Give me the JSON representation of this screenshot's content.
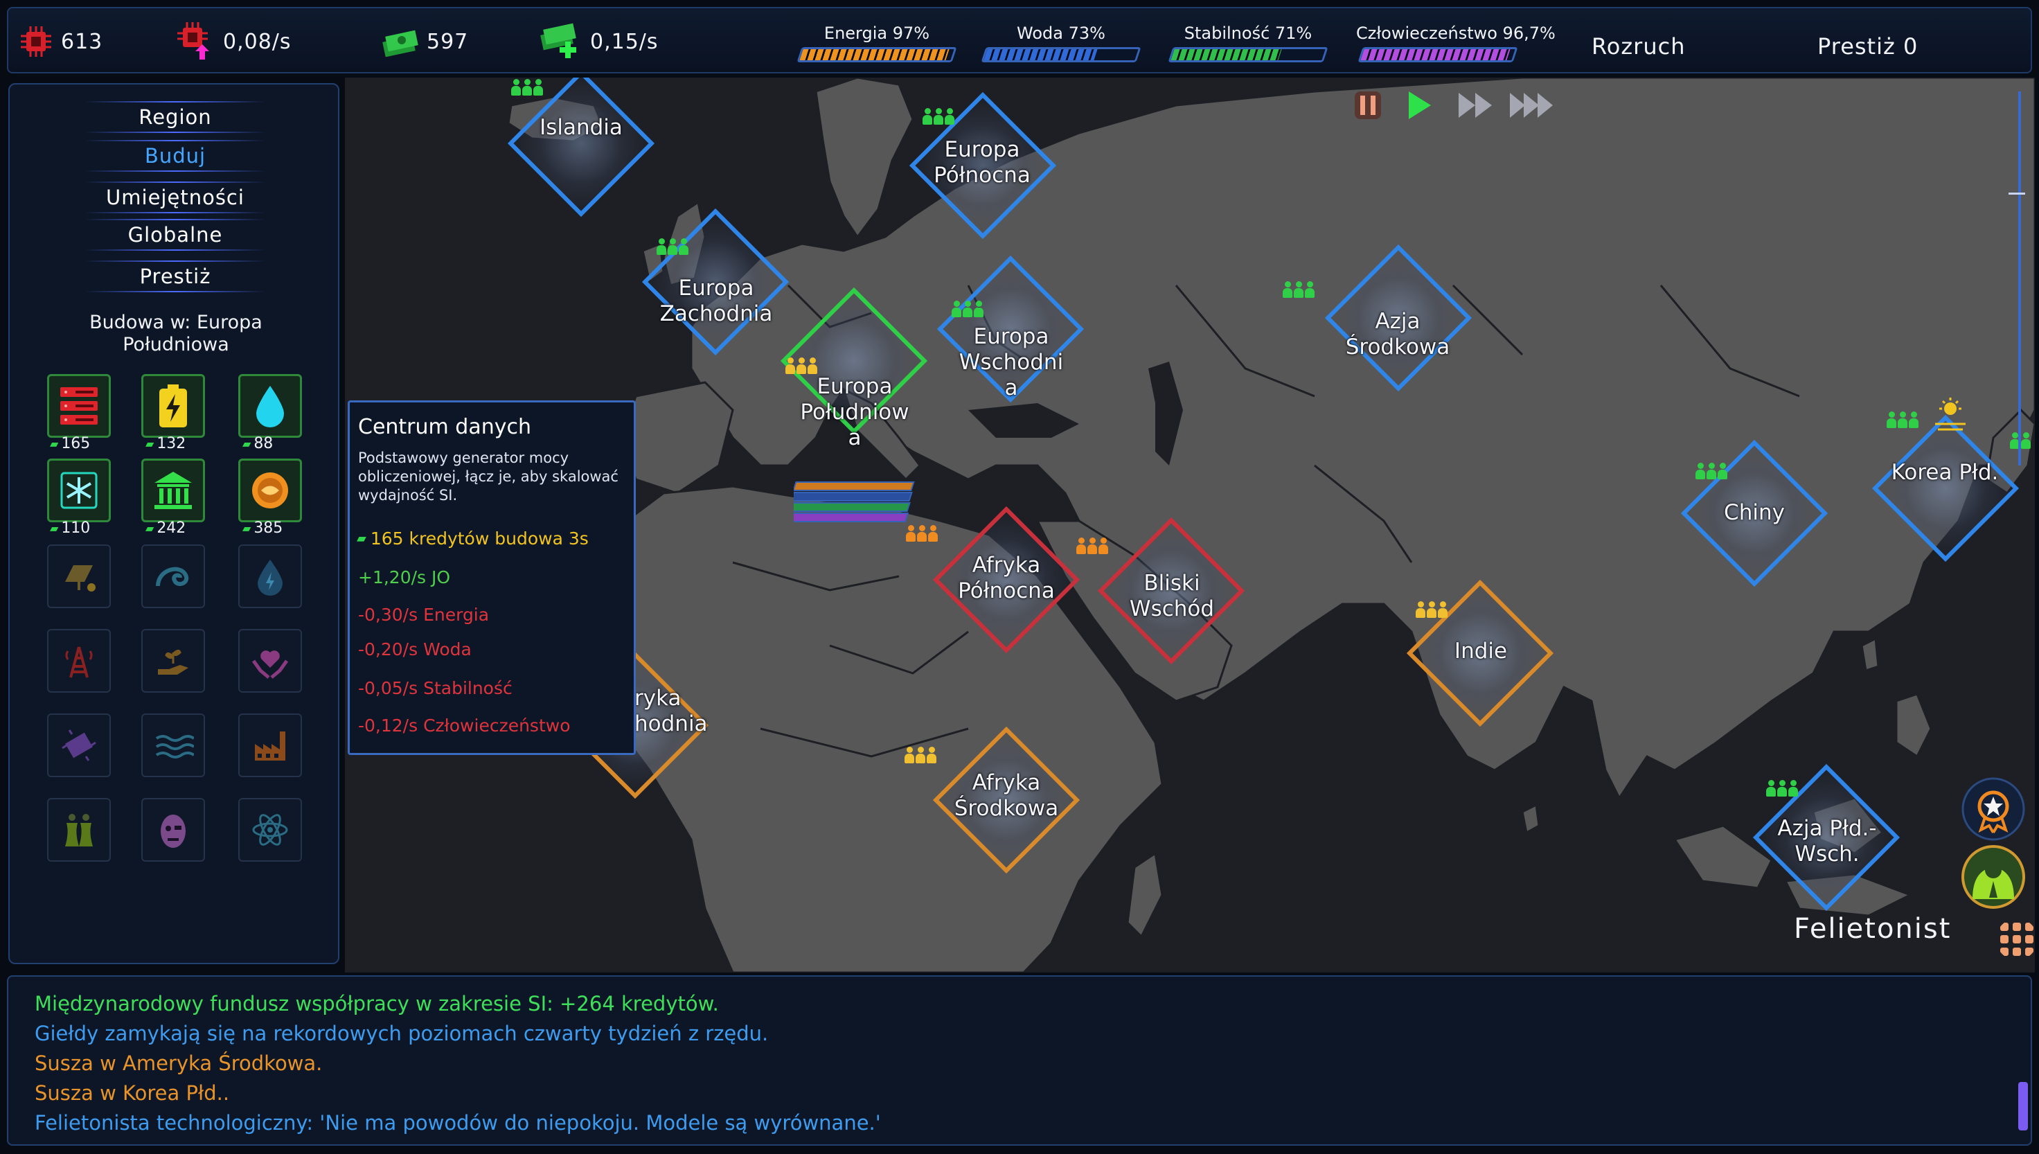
{
  "topbar": {
    "compute": {
      "value": "613",
      "icon": "cpu-icon"
    },
    "compute_rate": {
      "value": "0,08/s",
      "icon": "cpu-rate-icon"
    },
    "credits": {
      "value": "597",
      "icon": "cash-icon"
    },
    "credits_rate": {
      "value": "0,15/s",
      "icon": "cash-rate-icon"
    },
    "meters": [
      {
        "label": "Energia 97%",
        "level": 0.97,
        "color": "#f0921e"
      },
      {
        "label": "Woda 73%",
        "level": 0.73,
        "color": "#2f6ad8"
      },
      {
        "label": "Stabilność 71%",
        "level": 0.71,
        "color": "#2fbf4a"
      },
      {
        "label": "Człowieczeństwo 96,7%",
        "level": 0.967,
        "color": "#b44ee0"
      }
    ],
    "phase": "Rozruch",
    "prestige": "Prestiż 0"
  },
  "nav": {
    "items": [
      {
        "label": "Region",
        "active": false
      },
      {
        "label": "Buduj",
        "active": true
      },
      {
        "label": "Umiejętności",
        "active": false
      },
      {
        "label": "Globalne",
        "active": false
      },
      {
        "label": "Prestiż",
        "active": false
      }
    ]
  },
  "build": {
    "location_label": "Budowa w: Europa Południowa",
    "items": [
      {
        "icon": "server-rack-icon",
        "cost": "165",
        "available": true
      },
      {
        "icon": "battery-icon",
        "cost": "132",
        "available": true
      },
      {
        "icon": "water-drop-icon",
        "cost": "88",
        "available": true
      },
      {
        "icon": "snowflake-cooling-icon",
        "cost": "110",
        "available": true
      },
      {
        "icon": "government-building-icon",
        "cost": "242",
        "available": true
      },
      {
        "icon": "coin-icon",
        "cost": "385",
        "available": true
      },
      {
        "icon": "solar-panel-icon",
        "available": false
      },
      {
        "icon": "wave-icon",
        "available": false
      },
      {
        "icon": "drop-energy-icon",
        "available": false
      },
      {
        "icon": "radio-tower-icon",
        "available": false
      },
      {
        "icon": "hand-plant-icon",
        "available": false
      },
      {
        "icon": "heart-hands-icon",
        "available": false
      },
      {
        "icon": "chip-icon",
        "available": false
      },
      {
        "icon": "water-waves-icon",
        "available": false
      },
      {
        "icon": "factory-icon",
        "available": false
      },
      {
        "icon": "nuclear-plant-icon",
        "available": false
      },
      {
        "icon": "robot-face-icon",
        "available": false
      },
      {
        "icon": "atom-icon",
        "available": false
      }
    ]
  },
  "tooltip": {
    "title": "Centrum danych",
    "description": "Podstawowy generator mocy obliczeniowej, łącz je, aby skalować wydajność SI.",
    "cost_line": "165 kredytów  budowa 3s",
    "gain_line": "+1,20/s JO",
    "energy_line": "-0,30/s Energia",
    "water_line": "-0,20/s Woda",
    "stability_line": "-0,05/s Stabilność",
    "humanity_line": "-0,12/s Człowieczeństwo"
  },
  "regions": [
    {
      "name": "Islandia",
      "state": "blue",
      "people": "green"
    },
    {
      "name": "Europa Północna",
      "state": "blue",
      "people": "green"
    },
    {
      "name": "Europa Zachodnia",
      "state": "blue",
      "people": "green"
    },
    {
      "name": "Europa Wschodnia",
      "state": "blue",
      "people": "green"
    },
    {
      "name": "Europa Południowa",
      "state": "green",
      "people": "yellow"
    },
    {
      "name": "Azja Środkowa",
      "state": "blue",
      "people": "green"
    },
    {
      "name": "Chiny",
      "state": "blue",
      "people": "green"
    },
    {
      "name": "Korea Płd.",
      "state": "blue",
      "people": "green"
    },
    {
      "name": "Afryka Północna",
      "state": "red",
      "people": "orange"
    },
    {
      "name": "Bliski Wschód",
      "state": "red",
      "people": "orange"
    },
    {
      "name": "Indie",
      "state": "orange",
      "people": "yellow"
    },
    {
      "name": "Afryka Środkowa",
      "state": "orange",
      "people": "yellow"
    },
    {
      "name": "Azja Płd.-Wsch.",
      "state": "blue",
      "people": "green"
    },
    {
      "name": "Afryka Zachodnia",
      "state": "orange",
      "people": "none"
    }
  ],
  "region_labels": {
    "islandia": "Islandia",
    "europa_polnocna": [
      "Europa",
      "Północna"
    ],
    "europa_zachodnia": [
      "Europa",
      "Zachodnia"
    ],
    "europa_wschodnia": [
      "Europa",
      "Wschodni",
      "a"
    ],
    "europa_poludniowa": [
      "Europa",
      "Południow",
      "a"
    ],
    "azja_srodkowa": [
      "Azja",
      "Środkowa"
    ],
    "chiny": "Chiny",
    "korea": "Korea Płd.",
    "afryka_polnocna": [
      "Afryka",
      "Północna"
    ],
    "bliski_wschod": [
      "Bliski",
      "Wschód"
    ],
    "indie": "Indie",
    "afryka_srodkowa": [
      "Afryka",
      "Środkowa"
    ],
    "azja_pld": [
      "Azja Płd.-",
      "Wsch."
    ],
    "afryka_zach_partial": [
      "ryka",
      "hodnia"
    ]
  },
  "controls": {
    "pause": "pause-icon",
    "play": "play-icon",
    "fast": "fast-forward-icon",
    "faster": "fastest-forward-icon"
  },
  "side_buttons": [
    "achievement-badge-icon",
    "advisor-person-icon",
    "grid-menu-icon"
  ],
  "feletonist_label": "Felietonist",
  "news": [
    "Międzynarodowy fundusz współpracy w zakresie SI: +264 kredytów.",
    "Giełdy zamykają się na rekordowych poziomach czwarty tydzień z rzędu.",
    "Susza w Ameryka Środkowa.",
    "Susza w Korea Płd..",
    "Felietonista technologiczny: 'Nie ma powodów do niepokoju. Modele są wyrównane.'"
  ]
}
